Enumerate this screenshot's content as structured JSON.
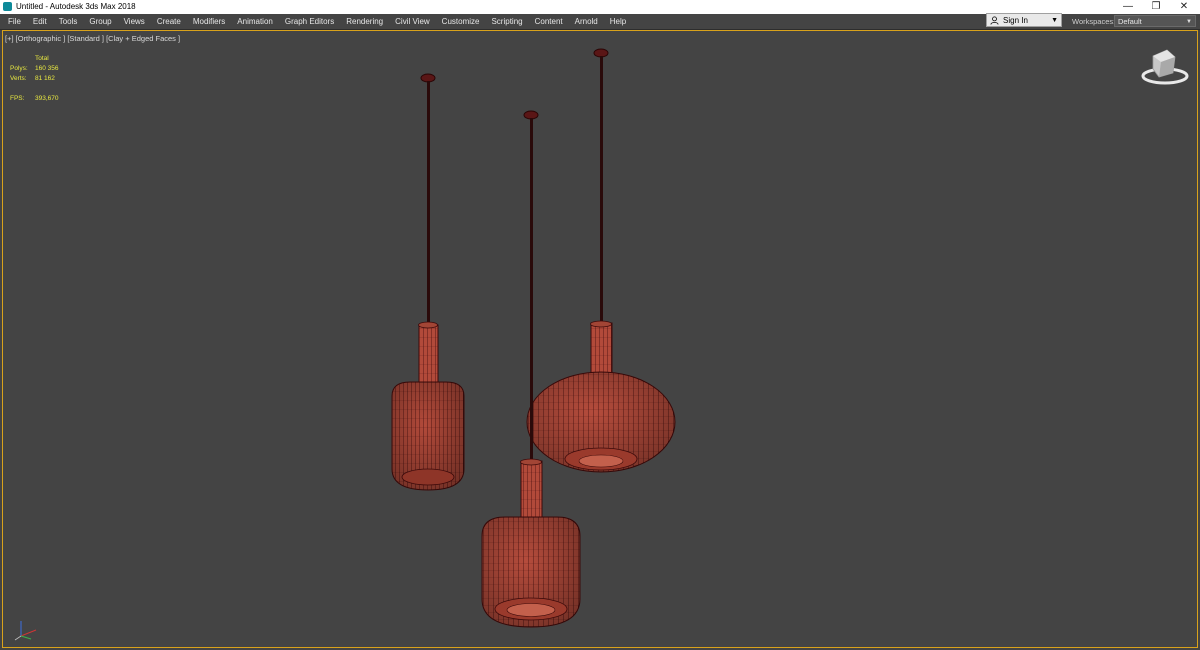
{
  "window": {
    "title": "Untitled - Autodesk 3ds Max 2018",
    "controls": {
      "minimize": "—",
      "restore": "❐",
      "close": "✕"
    }
  },
  "menu": {
    "items": [
      {
        "label": "File"
      },
      {
        "label": "Edit"
      },
      {
        "label": "Tools"
      },
      {
        "label": "Group"
      },
      {
        "label": "Views"
      },
      {
        "label": "Create"
      },
      {
        "label": "Modifiers"
      },
      {
        "label": "Animation"
      },
      {
        "label": "Graph Editors"
      },
      {
        "label": "Rendering"
      },
      {
        "label": "Civil View"
      },
      {
        "label": "Customize"
      },
      {
        "label": "Scripting"
      },
      {
        "label": "Content"
      },
      {
        "label": "Arnold"
      },
      {
        "label": "Help"
      }
    ]
  },
  "account": {
    "sign_in": "Sign In",
    "workspaces_label": "Workspaces:",
    "workspace_value": "Default"
  },
  "viewport": {
    "label": "[+] [Orthographic ] [Standard ] [Clay + Edged Faces ]",
    "stats": {
      "total_label": "Total",
      "polys_label": "Polys:",
      "polys_value": "160 356",
      "verts_label": "Verts:",
      "verts_value": "81 162",
      "fps_label": "FPS:",
      "fps_value": "393,670"
    }
  },
  "icons": {
    "app": "3ds-max-icon",
    "user": "user-icon",
    "viewcube": "viewcube-icon",
    "axis": "axis-tripod-icon"
  },
  "colors": {
    "viewport_bg": "#444444",
    "mesh_fill": "#b24a3a",
    "wire": "#3d0a0a",
    "active_border": "#d9a21b",
    "stats_text": "#e8e840"
  }
}
